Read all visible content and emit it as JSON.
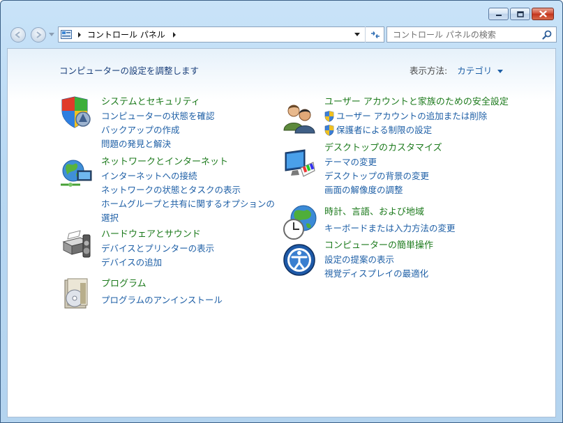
{
  "window": {
    "address_path": "コントロール パネル",
    "search_placeholder": "コントロール パネルの検索"
  },
  "content": {
    "heading": "コンピューターの設定を調整します",
    "view_by_label": "表示方法:",
    "view_by_value": "カテゴリ"
  },
  "categories_left": [
    {
      "title": "システムとセキュリティ",
      "icon": "shield-icon",
      "links": [
        "コンピューターの状態を確認",
        "バックアップの作成",
        "問題の発見と解決"
      ]
    },
    {
      "title": "ネットワークとインターネット",
      "icon": "network-icon",
      "links": [
        "インターネットへの接続",
        "ネットワークの状態とタスクの表示",
        "ホームグループと共有に関するオプションの",
        "選択"
      ]
    },
    {
      "title": "ハードウェアとサウンド",
      "icon": "printer-icon",
      "links": [
        "デバイスとプリンターの表示",
        "デバイスの追加"
      ]
    },
    {
      "title": "プログラム",
      "icon": "programs-icon",
      "links": [
        "プログラムのアンインストール"
      ]
    }
  ],
  "categories_right": [
    {
      "title": "ユーザー アカウントと家族のための安全設定",
      "icon": "users-icon",
      "links": [
        "ユーザー アカウントの追加または削除",
        "保護者による制限の設定"
      ]
    },
    {
      "title": "デスクトップのカスタマイズ",
      "icon": "desktop-icon",
      "links": [
        "テーマの変更",
        "デスクトップの背景の変更",
        "画面の解像度の調整"
      ]
    },
    {
      "title": "時計、言語、および地域",
      "icon": "clock-globe-icon",
      "links": [
        "キーボードまたは入力方法の変更"
      ]
    },
    {
      "title": "コンピューターの簡単操作",
      "icon": "ease-of-access-icon",
      "links": [
        "設定の提案の表示",
        "視覚ディスプレイの最適化"
      ]
    }
  ],
  "colors": {
    "link": "#1e5fa6",
    "category_title": "#1c7a1c",
    "heading": "#1a3f7a"
  }
}
